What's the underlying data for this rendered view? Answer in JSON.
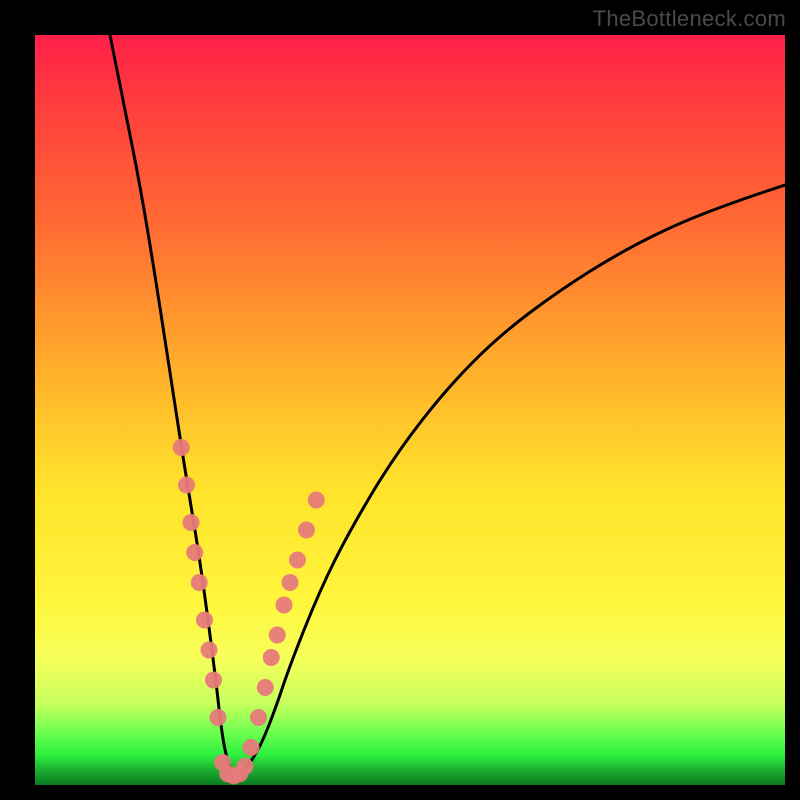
{
  "watermark": "TheBottleneck.com",
  "chart_data": {
    "type": "line",
    "title": "",
    "xlabel": "",
    "ylabel": "",
    "xlim": [
      0,
      100
    ],
    "ylim": [
      0,
      100
    ],
    "series": [
      {
        "name": "bottleneck-curve",
        "x": [
          10,
          12,
          14,
          16,
          18,
          20,
          22,
          24,
          25,
          26,
          27,
          28,
          30,
          32,
          34,
          38,
          42,
          48,
          55,
          62,
          70,
          78,
          86,
          94,
          100
        ],
        "y": [
          100,
          90,
          80,
          68,
          55,
          42,
          30,
          15,
          6,
          2,
          1,
          2,
          5,
          10,
          16,
          26,
          34,
          44,
          53,
          60,
          66,
          71,
          75,
          78,
          80
        ]
      }
    ],
    "markers": {
      "name": "highlight-dots",
      "color": "#e77a7a",
      "points": [
        {
          "x": 19.5,
          "y": 45
        },
        {
          "x": 20.2,
          "y": 40
        },
        {
          "x": 20.8,
          "y": 35
        },
        {
          "x": 21.3,
          "y": 31
        },
        {
          "x": 21.9,
          "y": 27
        },
        {
          "x": 22.6,
          "y": 22
        },
        {
          "x": 23.2,
          "y": 18
        },
        {
          "x": 23.8,
          "y": 14
        },
        {
          "x": 24.4,
          "y": 9
        },
        {
          "x": 25.0,
          "y": 3
        },
        {
          "x": 25.7,
          "y": 1.5
        },
        {
          "x": 26.5,
          "y": 1.2
        },
        {
          "x": 27.3,
          "y": 1.5
        },
        {
          "x": 28.0,
          "y": 2.5
        },
        {
          "x": 28.8,
          "y": 5
        },
        {
          "x": 29.8,
          "y": 9
        },
        {
          "x": 30.7,
          "y": 13
        },
        {
          "x": 31.5,
          "y": 17
        },
        {
          "x": 32.3,
          "y": 20
        },
        {
          "x": 33.2,
          "y": 24
        },
        {
          "x": 34.0,
          "y": 27
        },
        {
          "x": 35.0,
          "y": 30
        },
        {
          "x": 36.2,
          "y": 34
        },
        {
          "x": 37.5,
          "y": 38
        }
      ]
    }
  }
}
